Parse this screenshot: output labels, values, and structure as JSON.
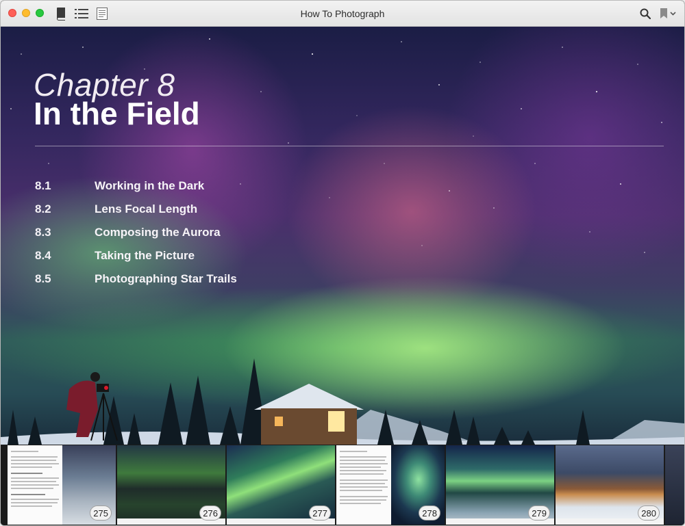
{
  "window": {
    "title": "How To Photograph",
    "buttons": {
      "library_icon": "book-icon",
      "toc_icon": "list-icon",
      "notes_icon": "notes-icon",
      "search_icon": "search-icon",
      "bookmark_icon": "bookmark-icon"
    }
  },
  "chapter": {
    "label": "Chapter 8",
    "title": "In the Field",
    "sections": [
      {
        "number": "8.1",
        "title": "Working in the Dark"
      },
      {
        "number": "8.2",
        "title": "Lens Focal Length"
      },
      {
        "number": "8.3",
        "title": "Composing the Aurora"
      },
      {
        "number": "8.4",
        "title": "Taking the Picture"
      },
      {
        "number": "8.5",
        "title": "Photographing Star Trails"
      }
    ]
  },
  "page_strip": {
    "pages": [
      "275",
      "276",
      "277",
      "278",
      "279",
      "280"
    ]
  },
  "colors": {
    "aurora_green": "#8de37a",
    "aurora_pink": "#d4649c",
    "sky_dark": "#1b1d45"
  }
}
